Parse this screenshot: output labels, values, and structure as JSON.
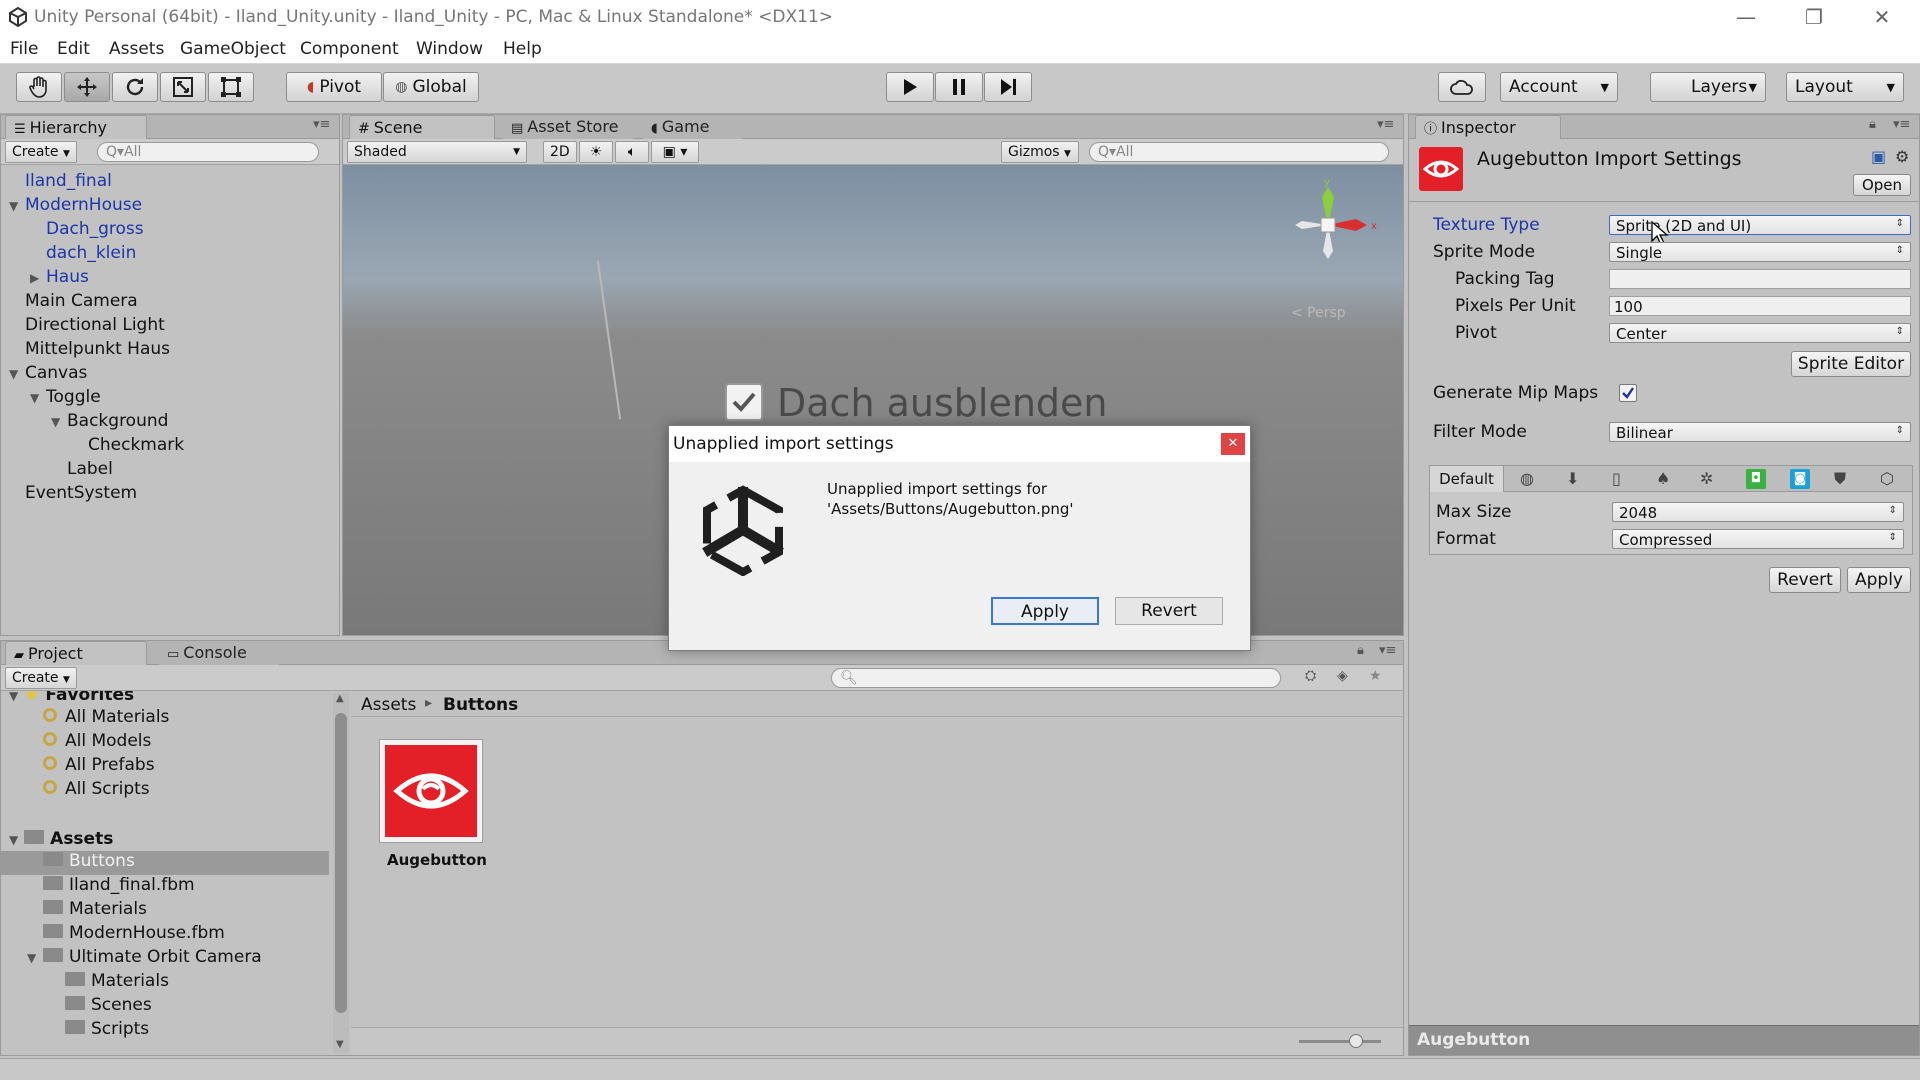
{
  "window": {
    "title": "Unity Personal (64bit) - Iland_Unity.unity - Iland_Unity - PC, Mac & Linux Standalone* <DX11>",
    "min_glyph": "—",
    "max_glyph": "❐",
    "close_glyph": "✕"
  },
  "menu": [
    "File",
    "Edit",
    "Assets",
    "GameObject",
    "Component",
    "Window",
    "Help"
  ],
  "toolbar": {
    "tools": [
      "hand-icon",
      "move-icon",
      "rotate-icon",
      "scale-icon",
      "rect-tool-icon"
    ],
    "pivot_label": "Pivot",
    "global_label": "Global",
    "play_glyph": "▶",
    "pause_glyph": "❚❚",
    "step_glyph": "▶❙",
    "account_label": "Account",
    "layers_label": "Layers",
    "layout_label": "Layout"
  },
  "hierarchy": {
    "tab": "Hierarchy",
    "create_label": "Create",
    "search_placeholder": "Q▾All",
    "items": [
      {
        "label": "Iland_final",
        "indent": 0,
        "blue": true,
        "arrow": ""
      },
      {
        "label": "ModernHouse",
        "indent": 0,
        "blue": true,
        "arrow": "▼"
      },
      {
        "label": "Dach_gross",
        "indent": 1,
        "blue": true,
        "arrow": ""
      },
      {
        "label": "dach_klein",
        "indent": 1,
        "blue": true,
        "arrow": ""
      },
      {
        "label": "Haus",
        "indent": 1,
        "blue": true,
        "arrow": "▶"
      },
      {
        "label": "Main Camera",
        "indent": 0,
        "blue": false,
        "arrow": ""
      },
      {
        "label": "Directional Light",
        "indent": 0,
        "blue": false,
        "arrow": ""
      },
      {
        "label": "Mittelpunkt Haus",
        "indent": 0,
        "blue": false,
        "arrow": ""
      },
      {
        "label": "Canvas",
        "indent": 0,
        "blue": false,
        "arrow": "▼"
      },
      {
        "label": "Toggle",
        "indent": 1,
        "blue": false,
        "arrow": "▼"
      },
      {
        "label": "Background",
        "indent": 2,
        "blue": false,
        "arrow": "▼"
      },
      {
        "label": "Checkmark",
        "indent": 3,
        "blue": false,
        "arrow": ""
      },
      {
        "label": "Label",
        "indent": 2,
        "blue": false,
        "arrow": ""
      },
      {
        "label": "EventSystem",
        "indent": 0,
        "blue": false,
        "arrow": ""
      }
    ]
  },
  "scene": {
    "tabs": [
      "Scene",
      "Asset Store",
      "Game"
    ],
    "shading": "Shaded",
    "mode_2d": "2D",
    "gizmos_label": "Gizmos",
    "search_placeholder": "Q▾All",
    "persp_label": "< Persp",
    "overlay_text": "Dach ausblenden",
    "axis_x": "x",
    "axis_y": "y"
  },
  "inspector": {
    "tab": "Inspector",
    "title": "Augebutton Import Settings",
    "open_label": "Open",
    "fields": {
      "texture_type_label": "Texture Type",
      "texture_type_value": "Sprite (2D and UI)",
      "sprite_mode_label": "Sprite Mode",
      "sprite_mode_value": "Single",
      "packing_tag_label": "Packing Tag",
      "packing_tag_value": "",
      "ppu_label": "Pixels Per Unit",
      "ppu_value": "100",
      "pivot_label": "Pivot",
      "pivot_value": "Center",
      "sprite_editor_label": "Sprite Editor",
      "mip_label": "Generate Mip Maps",
      "mip_checked": true,
      "filter_label": "Filter Mode",
      "filter_value": "Bilinear",
      "platform_default": "Default",
      "max_size_label": "Max Size",
      "max_size_value": "2048",
      "format_label": "Format",
      "format_value": "Compressed"
    },
    "revert_label": "Revert",
    "apply_label": "Apply",
    "footer": "Augebutton"
  },
  "project": {
    "tabs": [
      "Project",
      "Console"
    ],
    "create_label": "Create",
    "favorites_label": "Favorites",
    "favorites": [
      "All Materials",
      "All Models",
      "All Prefabs",
      "All Scripts"
    ],
    "assets_label": "Assets",
    "tree": [
      {
        "label": "Buttons",
        "indent": 1,
        "selected": true,
        "arrow": ""
      },
      {
        "label": "Iland_final.fbm",
        "indent": 1,
        "selected": false,
        "arrow": ""
      },
      {
        "label": "Materials",
        "indent": 1,
        "selected": false,
        "arrow": ""
      },
      {
        "label": "ModernHouse.fbm",
        "indent": 1,
        "selected": false,
        "arrow": ""
      },
      {
        "label": "Ultimate Orbit Camera",
        "indent": 1,
        "selected": false,
        "arrow": "▼"
      },
      {
        "label": "Materials",
        "indent": 2,
        "selected": false,
        "arrow": ""
      },
      {
        "label": "Scenes",
        "indent": 2,
        "selected": false,
        "arrow": ""
      },
      {
        "label": "Scripts",
        "indent": 2,
        "selected": false,
        "arrow": ""
      }
    ],
    "breadcrumb_root": "Assets",
    "breadcrumb_sep": "▸",
    "breadcrumb_current": "Buttons",
    "asset_name": "Augebutton"
  },
  "dialog": {
    "title": "Unapplied import settings",
    "message_line1": "Unapplied import settings for",
    "message_line2": "'Assets/Buttons/Augebutton.png'",
    "apply_label": "Apply",
    "revert_label": "Revert",
    "close_glyph": "✕"
  },
  "colors": {
    "accent_red": "#e32028",
    "link_blue": "#1c36a8",
    "dialog_close": "#e04343"
  }
}
